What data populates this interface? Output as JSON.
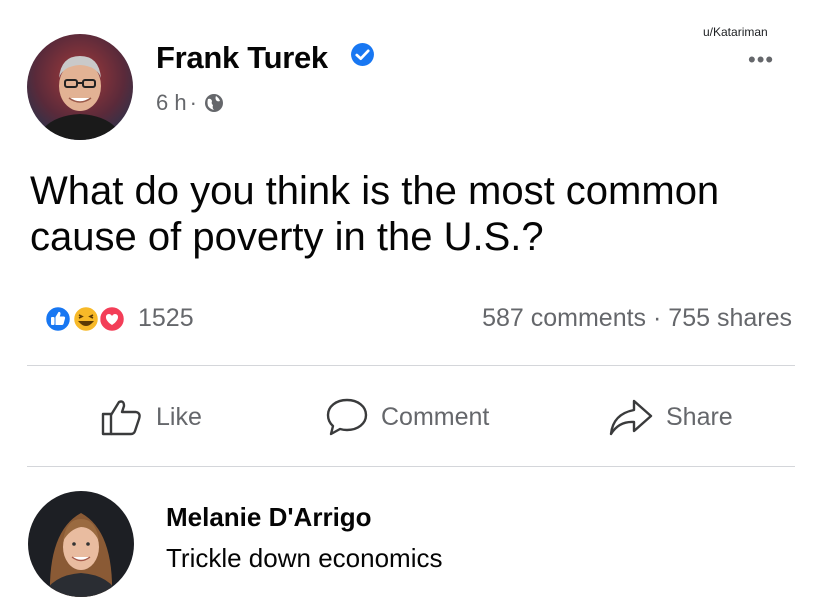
{
  "watermark": "u/Katariman",
  "post": {
    "author": "Frank Turek",
    "time": "6 h",
    "separator": "·",
    "text": "What do you think is the most common cause of poverty in the U.S.?",
    "reaction_count": "1525",
    "comments": "587 comments",
    "stats_separator": "·",
    "shares": "755 shares"
  },
  "actions": {
    "like": "Like",
    "comment": "Comment",
    "share": "Share"
  },
  "comment": {
    "author": "Melanie D'Arrigo",
    "text": "Trickle down economics"
  },
  "colors": {
    "facebook_blue": "#1877f2",
    "love_red": "#f33e58",
    "haha_yellow": "#f7b928",
    "muted_text": "#65676b"
  },
  "icons": [
    "more-options-icon",
    "verified-badge-icon",
    "globe-icon",
    "like-reaction-icon",
    "haha-reaction-icon",
    "love-reaction-icon",
    "thumbs-up-icon",
    "comment-bubble-icon",
    "share-arrow-icon"
  ]
}
